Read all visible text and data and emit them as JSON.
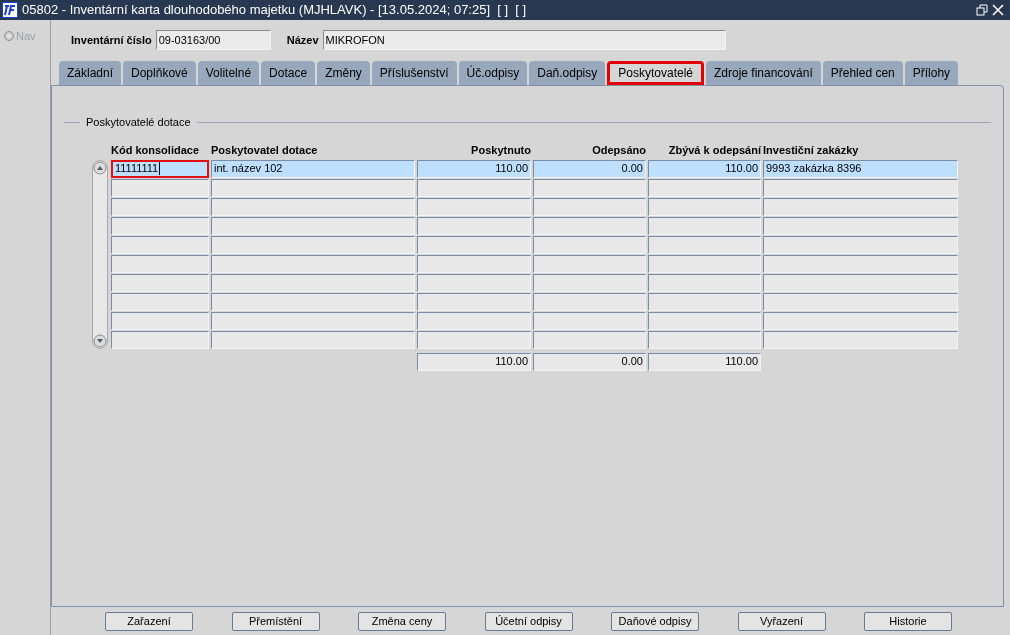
{
  "window": {
    "title": "05802 - Inventární karta dlouhodobého majetku (MJHLAVK) - [13.05.2024; 07:25]  [ ]  [ ]"
  },
  "nav": {
    "label": "Nav"
  },
  "header": {
    "fields": [
      {
        "label": "Inventární číslo",
        "value": "09-03163/00"
      },
      {
        "label": "Název",
        "value": "MIKROFON"
      }
    ]
  },
  "tabs": [
    {
      "label": "Základní",
      "selected": false
    },
    {
      "label": "Doplňkové",
      "selected": false
    },
    {
      "label": "Volitelné",
      "selected": false
    },
    {
      "label": "Dotace",
      "selected": false
    },
    {
      "label": "Změny",
      "selected": false
    },
    {
      "label": "Příslušenství",
      "selected": false
    },
    {
      "label": "Úč.odpisy",
      "selected": false
    },
    {
      "label": "Daň.odpisy",
      "selected": false
    },
    {
      "label": "Poskytovatelé",
      "selected": true
    },
    {
      "label": "Zdroje financování",
      "selected": false
    },
    {
      "label": "Přehled cen",
      "selected": false
    },
    {
      "label": "Přílohy",
      "selected": false
    }
  ],
  "section": {
    "title": "Poskytovatelé dotace"
  },
  "table": {
    "columns": [
      "Kód konsolidace",
      "Poskytovatel dotace",
      "Poskytnuto",
      "Odepsáno",
      "Zbývá k odepsání",
      "Investiční zakázky"
    ],
    "rows": [
      {
        "selected": true,
        "editing": true,
        "cells": [
          "11111111",
          "int. název 102",
          "110.00",
          "0.00",
          "110.00",
          "9993 zakázka 8396"
        ]
      },
      {
        "selected": false,
        "editing": false
      },
      {
        "selected": false,
        "editing": false
      },
      {
        "selected": false,
        "editing": false
      },
      {
        "selected": false,
        "editing": false
      },
      {
        "selected": false,
        "editing": false
      },
      {
        "selected": false,
        "editing": false
      },
      {
        "selected": false,
        "editing": false
      },
      {
        "selected": false,
        "editing": false
      },
      {
        "selected": false,
        "editing": false
      }
    ],
    "totals": [
      "110.00",
      "0.00",
      "110.00"
    ]
  },
  "buttons": [
    "Zařazení",
    "Přemístění",
    "Změna ceny",
    "Účetní odpisy",
    "Daňové odpisy",
    "Vyřazení",
    "Historie"
  ]
}
